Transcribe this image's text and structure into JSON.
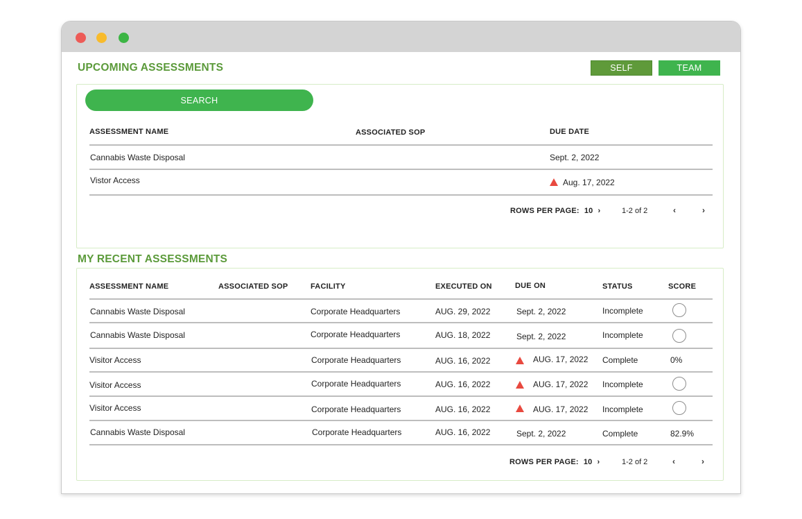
{
  "upcoming": {
    "title": "UPCOMING ASSESSMENTS",
    "toggle": {
      "self": "SELF",
      "team": "TEAM"
    },
    "search_label": "SEARCH",
    "columns": [
      "ASSESSMENT NAME",
      "ASSOCIATED SOP",
      "DUE DATE"
    ],
    "rows": [
      {
        "name": "Cannabis Waste Disposal",
        "sop": "",
        "due": "Sept. 2, 2022",
        "overdue": false
      },
      {
        "name": "Vistor Access",
        "sop": "",
        "due": "Aug. 17, 2022",
        "overdue": true
      }
    ],
    "pager": {
      "rows_label": "ROWS PER PAGE:",
      "rows_value": "10",
      "range": "1-2 of 2",
      "prev": "‹",
      "next": "›",
      "dropdown": "›"
    }
  },
  "recent": {
    "title": "MY RECENT ASSESSMENTS",
    "columns": [
      "ASSESSMENT NAME",
      "ASSOCIATED SOP",
      "FACILITY",
      "EXECUTED ON",
      "DUE ON",
      "STATUS",
      "SCORE"
    ],
    "rows": [
      {
        "name": "Cannabis Waste Disposal",
        "sop": "",
        "facility": "Corporate Headquarters",
        "executed": "AUG. 29, 2022",
        "due": "Sept. 2, 2022",
        "overdue": false,
        "status": "Incomplete",
        "score": ""
      },
      {
        "name": "Cannabis Waste Disposal",
        "sop": "",
        "facility": "Corporate Headquarters",
        "executed": "AUG. 18, 2022",
        "due": "Sept. 2, 2022",
        "overdue": false,
        "status": "Incomplete",
        "score": ""
      },
      {
        "name": "Visitor Access",
        "sop": "",
        "facility": "Corporate Headquarters",
        "executed": "AUG. 16, 2022",
        "due": "AUG. 17, 2022",
        "overdue": true,
        "status": "Complete",
        "score": "0%"
      },
      {
        "name": "Visitor Access",
        "sop": "",
        "facility": "Corporate Headquarters",
        "executed": "AUG. 16, 2022",
        "due": "AUG. 17, 2022",
        "overdue": true,
        "status": "Incomplete",
        "score": ""
      },
      {
        "name": "Visitor Access",
        "sop": "",
        "facility": "Corporate Headquarters",
        "executed": "AUG. 16, 2022",
        "due": "AUG. 17, 2022",
        "overdue": true,
        "status": "Incomplete",
        "score": ""
      },
      {
        "name": "Cannabis Waste Disposal",
        "sop": "",
        "facility": "Corporate Headquarters",
        "executed": "AUG. 16, 2022",
        "due": "Sept. 2, 2022",
        "overdue": false,
        "status": "Complete",
        "score": "82.9%"
      }
    ],
    "pager": {
      "rows_label": "ROWS PER PAGE:",
      "rows_value": "10",
      "range": "1-2 of 2",
      "prev": "‹",
      "next": "›",
      "dropdown": "›"
    }
  },
  "colors": {
    "accent_green": "#3fb44e",
    "dark_green": "#5f9a3a",
    "warning_red": "#e8493f"
  },
  "icons": {
    "overdue": "warning-triangle-icon",
    "empty_score": "empty-circle-icon"
  }
}
